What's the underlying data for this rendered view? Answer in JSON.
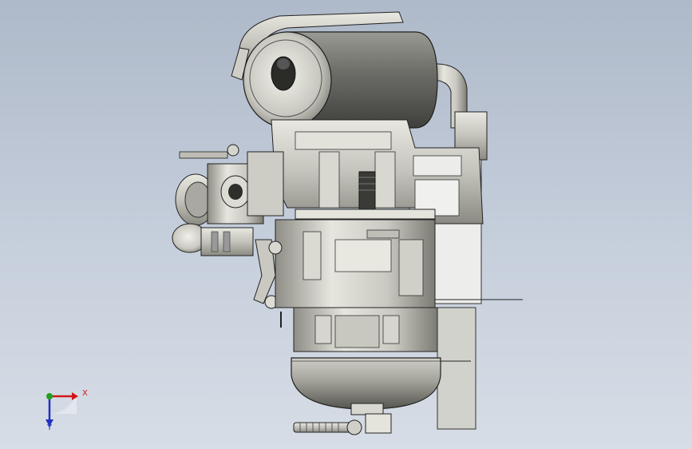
{
  "viewport": {
    "background_top": "#aeb9c9",
    "background_bottom": "#d7dde6",
    "model": "engine-assembly"
  },
  "triad": {
    "x_label": "X",
    "y_label": "Y",
    "x_color": "#d01818",
    "y_color": "#2030c0",
    "origin_color": "#20a020"
  }
}
